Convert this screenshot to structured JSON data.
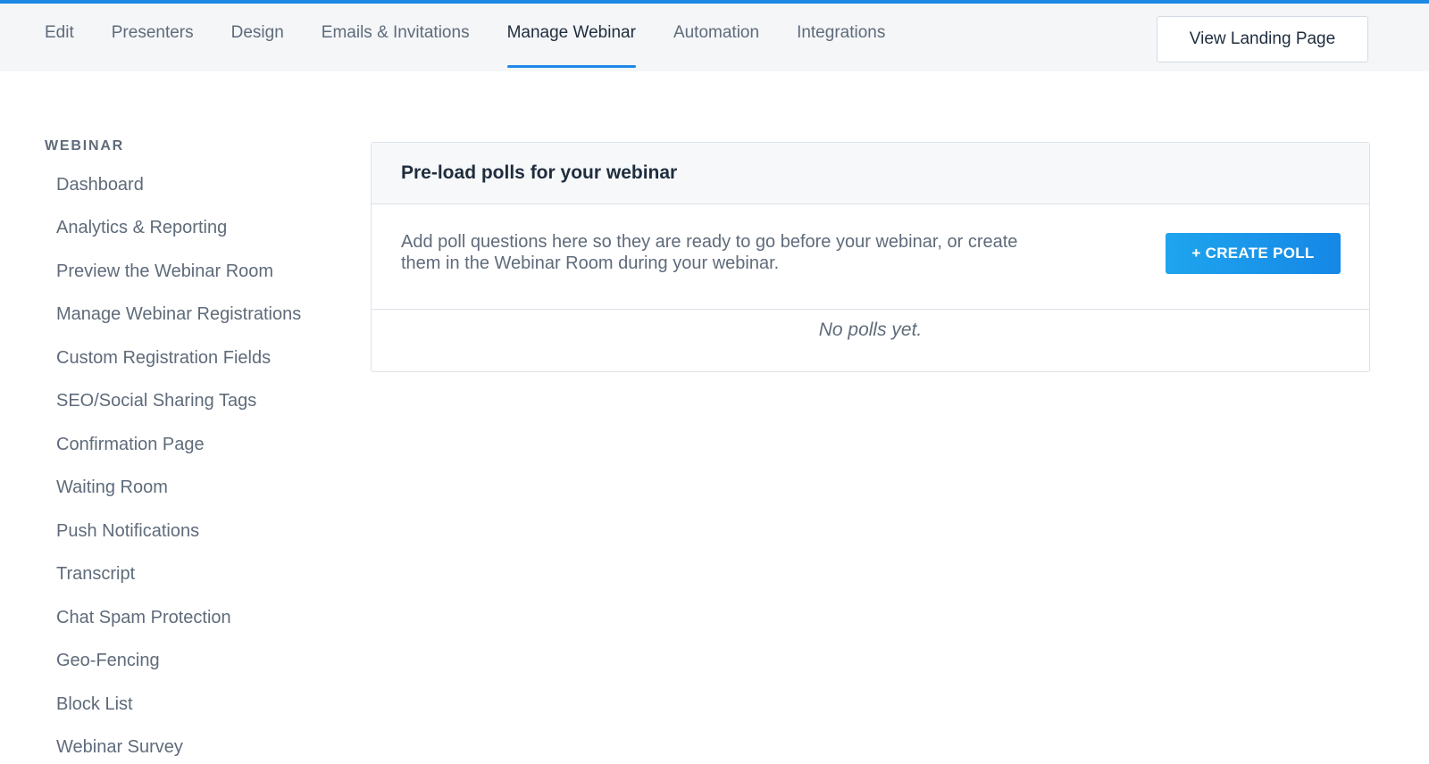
{
  "top_nav": {
    "tabs": [
      {
        "label": "Edit",
        "active": false
      },
      {
        "label": "Presenters",
        "active": false
      },
      {
        "label": "Design",
        "active": false
      },
      {
        "label": "Emails & Invitations",
        "active": false
      },
      {
        "label": "Manage Webinar",
        "active": true
      },
      {
        "label": "Automation",
        "active": false
      },
      {
        "label": "Integrations",
        "active": false
      }
    ],
    "view_landing_label": "View Landing Page"
  },
  "sidebar": {
    "heading": "WEBINAR",
    "items": [
      {
        "label": "Dashboard"
      },
      {
        "label": "Analytics & Reporting"
      },
      {
        "label": "Preview the Webinar Room"
      },
      {
        "label": "Manage Webinar Registrations"
      },
      {
        "label": "Custom Registration Fields"
      },
      {
        "label": "SEO/Social Sharing Tags"
      },
      {
        "label": "Confirmation Page"
      },
      {
        "label": "Waiting Room"
      },
      {
        "label": "Push Notifications"
      },
      {
        "label": "Transcript"
      },
      {
        "label": "Chat Spam Protection"
      },
      {
        "label": "Geo-Fencing"
      },
      {
        "label": "Block List"
      },
      {
        "label": "Webinar Survey"
      }
    ]
  },
  "panel": {
    "title": "Pre-load polls for your webinar",
    "description": "Add poll questions here so they are ready to go before your webinar, or create them in the Webinar Room during your webinar.",
    "create_button_label": "+ CREATE POLL",
    "empty_text": "No polls yet."
  },
  "colors": {
    "accent": "#1e88e5",
    "text_primary": "#1f2d3d",
    "text_secondary": "#5f6b7a",
    "nav_background": "#f4f6f8"
  }
}
